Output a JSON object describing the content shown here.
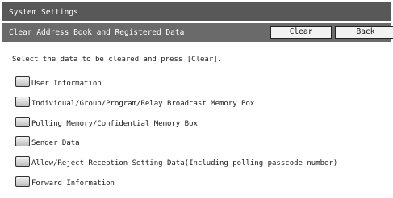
{
  "window": {
    "title": "System Settings",
    "subtitle": "Clear Address Book and Registered Data",
    "clear_label": "Clear",
    "back_label": "Back"
  },
  "instruction": "Select the data to be cleared and press [Clear].",
  "options": [
    {
      "label": "User Information",
      "checked": false
    },
    {
      "label": "Individual/Group/Program/Relay Broadcast Memory Box",
      "checked": false
    },
    {
      "label": "Polling Memory/Confidential Memory Box",
      "checked": false
    },
    {
      "label": "Sender Data",
      "checked": false
    },
    {
      "label": "Allow/Reject Reception Setting Data(Including polling passcode number)",
      "checked": false
    },
    {
      "label": "Forward Information",
      "checked": false
    }
  ]
}
